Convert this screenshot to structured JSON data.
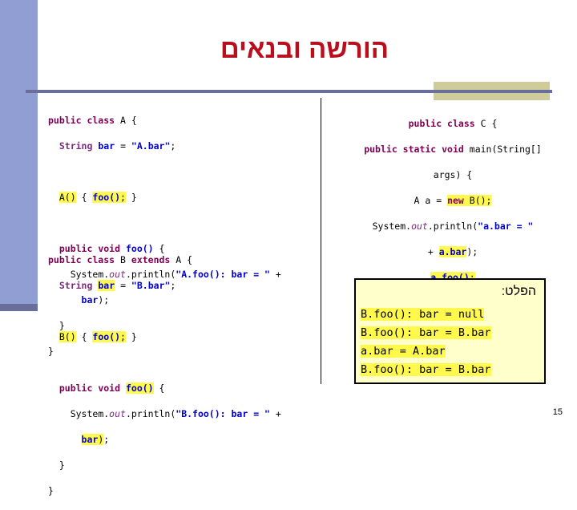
{
  "slide": {
    "title": "הורשה ובנאים",
    "page_number": "15",
    "title_color": "#B90F1C",
    "sidebar_color": "#909ED4",
    "sidebar_foot_color": "#6A6E9B",
    "rule_color": "#6A6E9B",
    "tab_color": "#CFCB9A",
    "highlight_color": "#FFF84D",
    "output_box_bg": "#FFFFCC",
    "keyword_color": "#800055",
    "string_color": "#0000CC"
  },
  "code_a": {
    "lines": [
      "public class A {",
      "  String bar = \"A.bar\";",
      "",
      "  A() { foo(); }",
      "",
      "  public void foo() {",
      "    System.out.println(\"A.foo(): bar = \" +",
      "      bar);",
      "  }",
      "}"
    ]
  },
  "code_b": {
    "lines": [
      "public class B extends A {",
      "  String bar = \"B.bar\";",
      "",
      "  B() { foo(); }",
      "",
      "  public void foo() {",
      "    System.out.println(\"B.foo(): bar = \" +",
      "      bar);",
      "  }",
      "}"
    ]
  },
  "code_c": {
    "lines": [
      "public class C {",
      "  public static void main(String[]",
      "      args) {",
      "    A a = new B();",
      "    System.out.println(\"a.bar = \"",
      "       + a.bar);",
      "    a.foo();",
      "  }",
      "}"
    ]
  },
  "output": {
    "label": "הפלט:",
    "lines": [
      "B.foo(): bar = null",
      "B.foo(): bar = B.bar",
      "a.bar = A.bar",
      "B.foo(): bar = B.bar"
    ]
  }
}
